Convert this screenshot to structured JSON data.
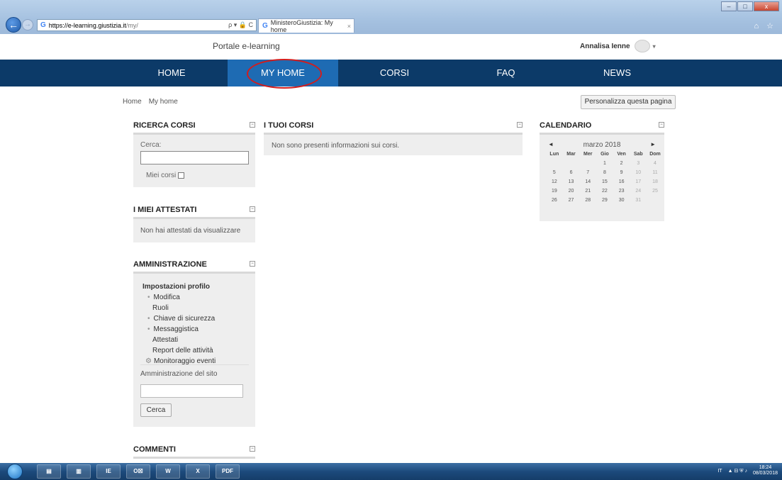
{
  "browser": {
    "url_host": "https://e-learning.giustizia.it",
    "url_path": "/my/",
    "tab_title": "MinisteroGiustizia: My home",
    "tab_close": "×",
    "back": "←",
    "forward": "→",
    "addr_controls": "ρ ▾ 🔒 C",
    "chrome_icons": "⌂ ☆"
  },
  "header": {
    "portal_title": "Portale e-learning",
    "user_name": "Annalisa Ienne",
    "user_caret": "▾"
  },
  "nav": {
    "items": [
      "HOME",
      "MY HOME",
      "CORSI",
      "FAQ",
      "NEWS"
    ],
    "active_index": 1
  },
  "breadcrumb": [
    "Home",
    "My home"
  ],
  "personalize_button": "Personalizza questa pagina",
  "blocks": {
    "ricerca": {
      "title": "RICERCA CORSI",
      "search_label": "Cerca:",
      "search_value": "",
      "miei_corsi_label": "Miei corsi"
    },
    "attestati": {
      "title": "I MIEI ATTESTATI",
      "message": "Non hai attestati da visualizzare"
    },
    "amministrazione": {
      "title": "AMMINISTRAZIONE",
      "section": "Impostazioni profilo",
      "items": [
        {
          "label": "Modifica",
          "bullet": true
        },
        {
          "label": "Ruoli",
          "bullet": false
        },
        {
          "label": "Chiave di sicurezza",
          "bullet": true
        },
        {
          "label": "Messaggistica",
          "bullet": true
        },
        {
          "label": "Attestati",
          "bullet": false
        },
        {
          "label": "Report delle attività",
          "bullet": false
        },
        {
          "label": "Monitoraggio eventi",
          "bullet": false,
          "icon": "gear-icon"
        }
      ],
      "site_admin": "Amministrazione del sito",
      "search_value": "",
      "search_button": "Cerca"
    },
    "commenti": {
      "title": "COMMENTI"
    },
    "tuoi_corsi": {
      "title": "I TUOI CORSI",
      "message": "Non sono presenti informazioni sui corsi."
    },
    "calendario": {
      "title": "CALENDARIO",
      "month": "marzo 2018",
      "prev": "◄",
      "next": "►",
      "weekdays": [
        "Lun",
        "Mar",
        "Mer",
        "Gio",
        "Ven",
        "Sab",
        "Dom"
      ],
      "weeks": [
        [
          "",
          "",
          "",
          "1",
          "2",
          "3",
          "4"
        ],
        [
          "5",
          "6",
          "7",
          "8",
          "9",
          "10",
          "11"
        ],
        [
          "12",
          "13",
          "14",
          "15",
          "16",
          "17",
          "18"
        ],
        [
          "19",
          "20",
          "21",
          "22",
          "23",
          "24",
          "25"
        ],
        [
          "26",
          "27",
          "28",
          "29",
          "30",
          "31",
          ""
        ]
      ]
    }
  },
  "taskbar": {
    "apps": [
      "IE",
      "O☒",
      "W",
      "X",
      "PDF"
    ],
    "lang": "IT",
    "time": "18:24",
    "date": "08/03/2018"
  },
  "colors": {
    "nav_bg": "#0c3a68",
    "nav_active": "#1e6bb3",
    "annotation_circle": "#d21d1d",
    "block_bg": "#eeeeee"
  }
}
